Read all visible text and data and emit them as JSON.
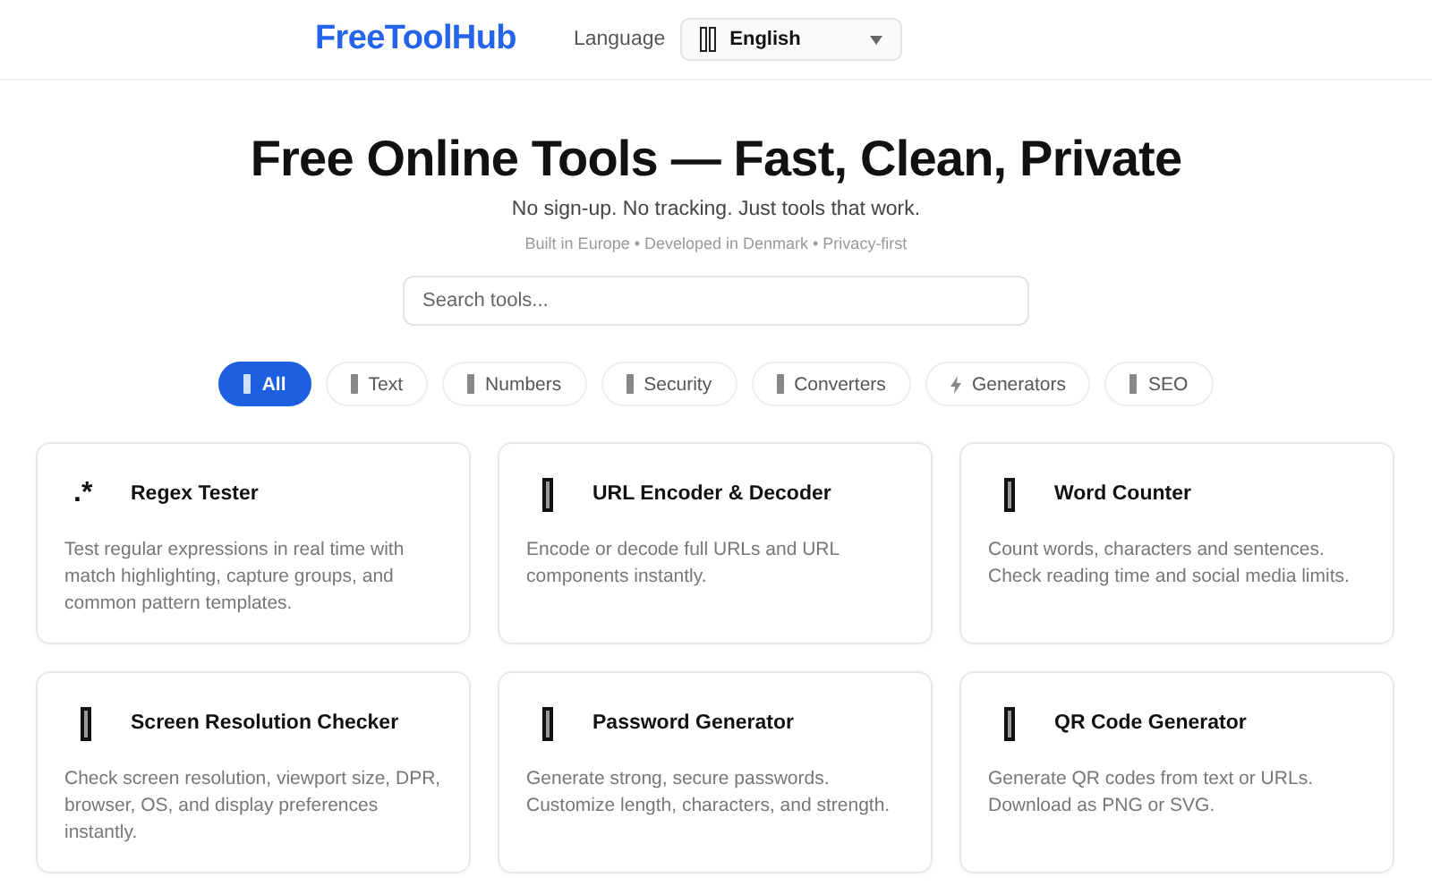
{
  "header": {
    "logo": "FreeToolHub",
    "language_label": "Language",
    "language": {
      "value": "English"
    }
  },
  "hero": {
    "title": "Free Online Tools — Fast, Clean, Private",
    "subtitle": "No sign-up. No tracking. Just tools that work.",
    "note": "Built in Europe • Developed in Denmark • Privacy-first"
  },
  "search": {
    "placeholder": "Search tools..."
  },
  "filters": [
    {
      "label": "All",
      "kind": "box",
      "selected": true
    },
    {
      "label": "Text",
      "kind": "box",
      "selected": false
    },
    {
      "label": "Numbers",
      "kind": "box",
      "selected": false
    },
    {
      "label": "Security",
      "kind": "box",
      "selected": false
    },
    {
      "label": "Converters",
      "kind": "box",
      "selected": false
    },
    {
      "label": "Generators",
      "kind": "bolt",
      "selected": false
    },
    {
      "label": "SEO",
      "kind": "box",
      "selected": false
    }
  ],
  "tools": [
    {
      "kind": "glyph",
      "glyph": ".*",
      "title": "Regex Tester",
      "description": "Test regular expressions in real time with match highlighting, capture groups, and common pattern templates."
    },
    {
      "kind": "box",
      "title": "URL Encoder & Decoder",
      "description": "Encode or decode full URLs and URL components instantly."
    },
    {
      "kind": "box",
      "title": "Word Counter",
      "description": "Count words, characters and sentences. Check reading time and social media limits."
    },
    {
      "kind": "box",
      "title": "Screen Resolution Checker",
      "description": "Check screen resolution, viewport size, DPR, browser, OS, and display preferences instantly."
    },
    {
      "kind": "box",
      "title": "Password Generator",
      "description": "Generate strong, secure passwords. Customize length, characters, and strength."
    },
    {
      "kind": "box",
      "title": "QR Code Generator",
      "description": "Generate QR codes from text or URLs. Download as PNG or SVG."
    }
  ]
}
